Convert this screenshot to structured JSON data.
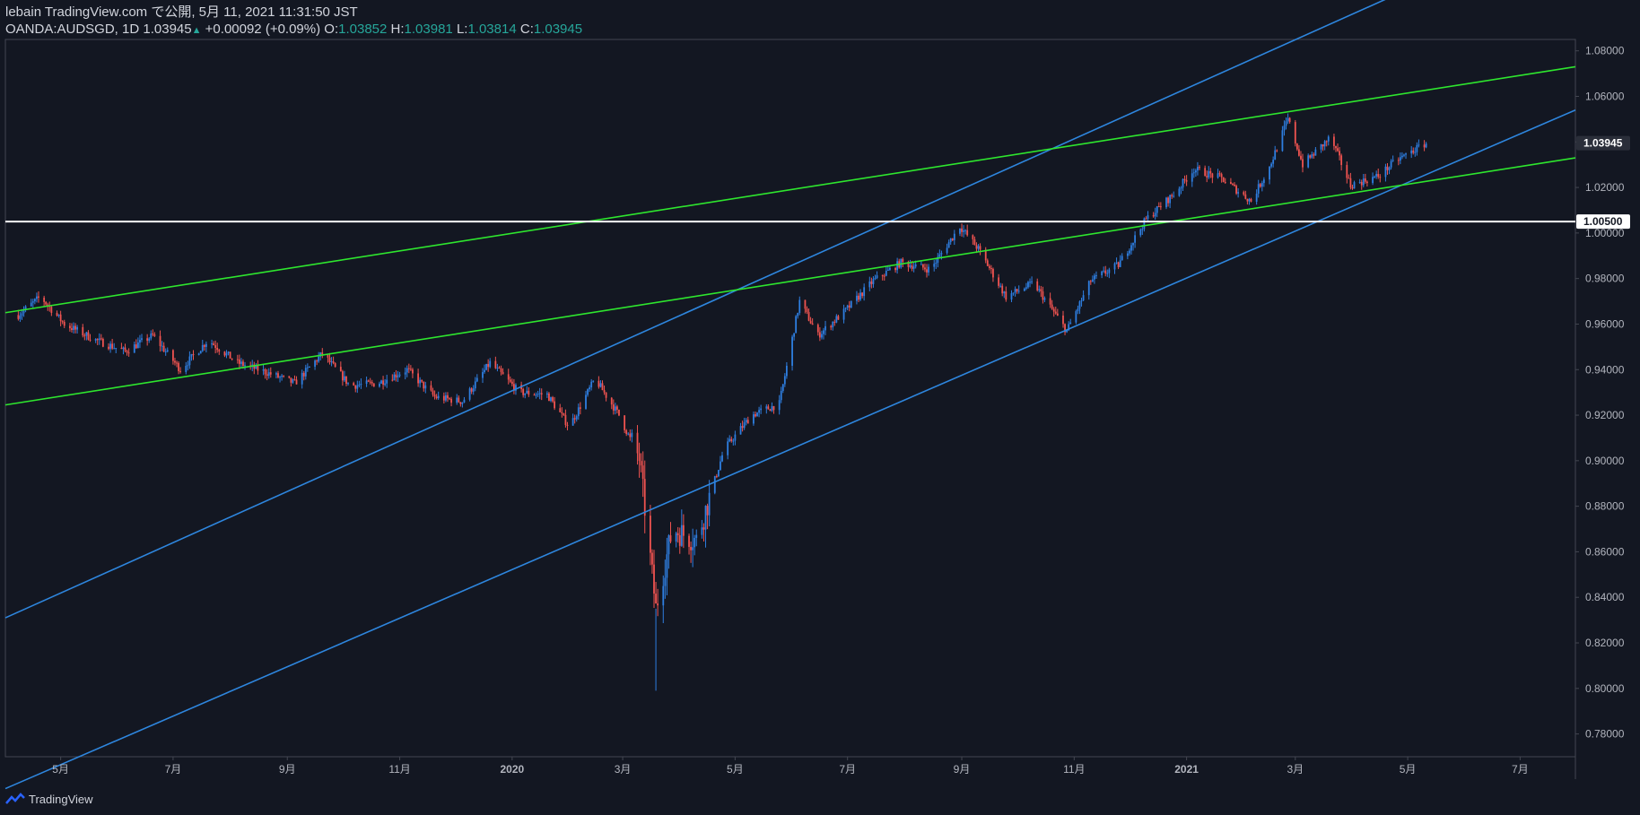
{
  "header": {
    "line1": "lebain TradingView.com で公開, 5月 11, 2021 11:31:50 JST",
    "symbol": "OANDA:AUDSGD, 1D",
    "last": "1.03945",
    "arrow": "▲",
    "change": "+0.00092 (+0.09%)",
    "o_label": "O:",
    "o_val": "1.03852",
    "h_label": "H:",
    "h_val": "1.03981",
    "l_label": "L:",
    "l_val": "1.03814",
    "c_label": "C:",
    "c_val": "1.03945"
  },
  "footer": {
    "brand": "TradingView",
    "logo_icon": "tradingview-logo-icon"
  },
  "colors": {
    "background": "#131722",
    "up": "#2e7ee0",
    "down": "#ef5350",
    "channel": "#2e86de",
    "trend": "#2ee62e",
    "level": "#ffffff",
    "axis_text": "#b2b5be"
  },
  "chart_data": {
    "type": "candlestick",
    "symbol": "OANDA:AUDSGD",
    "interval": "1D",
    "ylim": [
      0.77,
      1.085
    ],
    "y_ticks": [
      "1.08000",
      "1.06000",
      "1.04000",
      "1.02000",
      "1.00000",
      "0.98000",
      "0.96000",
      "0.94000",
      "0.92000",
      "0.90000",
      "0.88000",
      "0.86000",
      "0.84000",
      "0.82000",
      "0.80000",
      "0.78000"
    ],
    "x_range": [
      "2019-04-01",
      "2021-07-31"
    ],
    "x_ticks": [
      {
        "label": "5月",
        "date": "2019-05-01"
      },
      {
        "label": "7月",
        "date": "2019-07-01"
      },
      {
        "label": "9月",
        "date": "2019-09-01"
      },
      {
        "label": "11月",
        "date": "2019-11-01"
      },
      {
        "label": "2020",
        "date": "2020-01-01"
      },
      {
        "label": "3月",
        "date": "2020-03-01"
      },
      {
        "label": "5月",
        "date": "2020-05-01"
      },
      {
        "label": "7月",
        "date": "2020-07-01"
      },
      {
        "label": "9月",
        "date": "2020-09-01"
      },
      {
        "label": "11月",
        "date": "2020-11-01"
      },
      {
        "label": "2021",
        "date": "2021-01-01"
      },
      {
        "label": "3月",
        "date": "2021-03-01"
      },
      {
        "label": "5月",
        "date": "2021-05-01"
      },
      {
        "label": "7月",
        "date": "2021-07-01"
      }
    ],
    "price_path": [
      [
        "2019-04-08",
        0.964
      ],
      [
        "2019-04-20",
        0.972
      ],
      [
        "2019-05-03",
        0.96
      ],
      [
        "2019-05-20",
        0.953
      ],
      [
        "2019-06-05",
        0.948
      ],
      [
        "2019-06-20",
        0.955
      ],
      [
        "2019-07-05",
        0.94
      ],
      [
        "2019-07-20",
        0.953
      ],
      [
        "2019-08-05",
        0.943
      ],
      [
        "2019-08-20",
        0.939
      ],
      [
        "2019-09-05",
        0.934
      ],
      [
        "2019-09-20",
        0.947
      ],
      [
        "2019-10-05",
        0.933
      ],
      [
        "2019-10-20",
        0.934
      ],
      [
        "2019-11-05",
        0.94
      ],
      [
        "2019-11-20",
        0.928
      ],
      [
        "2019-12-05",
        0.926
      ],
      [
        "2019-12-20",
        0.943
      ],
      [
        "2020-01-05",
        0.93
      ],
      [
        "2020-01-20",
        0.929
      ],
      [
        "2020-02-01",
        0.915
      ],
      [
        "2020-02-15",
        0.936
      ],
      [
        "2020-02-28",
        0.92
      ],
      [
        "2020-03-10",
        0.901
      ],
      [
        "2020-03-19",
        0.835
      ],
      [
        "2020-03-28",
        0.87
      ],
      [
        "2020-04-10",
        0.865
      ],
      [
        "2020-04-25",
        0.905
      ],
      [
        "2020-05-10",
        0.92
      ],
      [
        "2020-05-25",
        0.925
      ],
      [
        "2020-06-05",
        0.97
      ],
      [
        "2020-06-15",
        0.955
      ],
      [
        "2020-06-30",
        0.966
      ],
      [
        "2020-07-15",
        0.979
      ],
      [
        "2020-07-30",
        0.987
      ],
      [
        "2020-08-15",
        0.984
      ],
      [
        "2020-08-31",
        1.003
      ],
      [
        "2020-09-10",
        0.993
      ],
      [
        "2020-09-25",
        0.972
      ],
      [
        "2020-10-10",
        0.978
      ],
      [
        "2020-10-28",
        0.957
      ],
      [
        "2020-11-10",
        0.979
      ],
      [
        "2020-11-25",
        0.986
      ],
      [
        "2020-12-10",
        1.006
      ],
      [
        "2020-12-25",
        1.017
      ],
      [
        "2021-01-05",
        1.028
      ],
      [
        "2021-01-20",
        1.024
      ],
      [
        "2021-02-05",
        1.014
      ],
      [
        "2021-02-15",
        1.029
      ],
      [
        "2021-02-25",
        1.05
      ],
      [
        "2021-03-05",
        1.03
      ],
      [
        "2021-03-20",
        1.042
      ],
      [
        "2021-03-31",
        1.021
      ],
      [
        "2021-04-15",
        1.025
      ],
      [
        "2021-04-25",
        1.032
      ],
      [
        "2021-05-11",
        1.03945
      ]
    ],
    "lines": [
      {
        "name": "blue-channel-upper",
        "color": "channel",
        "p1": [
          "2019-04-01",
          0.831
        ],
        "p2": [
          "2021-07-31",
          1.14
        ]
      },
      {
        "name": "blue-channel-lower",
        "color": "channel",
        "p1": [
          "2019-04-01",
          0.756
        ],
        "p2": [
          "2021-07-31",
          1.054
        ]
      },
      {
        "name": "green-trend-upper",
        "color": "trend",
        "p1": [
          "2019-04-01",
          0.965
        ],
        "p2": [
          "2021-07-31",
          1.073
        ]
      },
      {
        "name": "green-trend-lower",
        "color": "trend",
        "p1": [
          "2019-04-01",
          0.9245
        ],
        "p2": [
          "2021-07-31",
          1.033
        ]
      },
      {
        "name": "horizontal-level",
        "color": "level",
        "p1": [
          "2019-04-01",
          1.005
        ],
        "p2": [
          "2021-07-31",
          1.005
        ]
      }
    ],
    "price_labels": [
      {
        "name": "last-price-label",
        "value": "1.03945",
        "price": 1.03945,
        "style": "last"
      },
      {
        "name": "level-price-label",
        "value": "1.00500",
        "price": 1.005,
        "style": "level"
      }
    ]
  }
}
